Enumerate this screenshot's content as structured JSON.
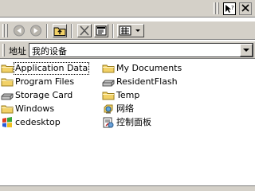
{
  "address": {
    "label": "地址",
    "value": "我的设备"
  },
  "items": [
    {
      "label": "Application Data",
      "icon": "folder-icon"
    },
    {
      "label": "Program Files",
      "icon": "folder-icon"
    },
    {
      "label": "Storage Card",
      "icon": "storage-card-icon"
    },
    {
      "label": "Windows",
      "icon": "folder-icon"
    },
    {
      "label": "cedesktop",
      "icon": "windows-logo-icon"
    },
    {
      "label": "My Documents",
      "icon": "folder-icon"
    },
    {
      "label": "ResidentFlash",
      "icon": "flash-drive-icon"
    },
    {
      "label": "Temp",
      "icon": "folder-icon"
    },
    {
      "label": "网络",
      "icon": "network-icon"
    },
    {
      "label": "控制面板",
      "icon": "control-panel-icon"
    }
  ],
  "toolbar_icons": [
    "back-icon",
    "forward-icon",
    "up-folder-icon",
    "delete-icon",
    "properties-icon",
    "view-menu-icon"
  ],
  "colors": {
    "chrome": "#d4d0c8",
    "folder": "#f2d167",
    "folder_edge": "#9a7d1c"
  }
}
